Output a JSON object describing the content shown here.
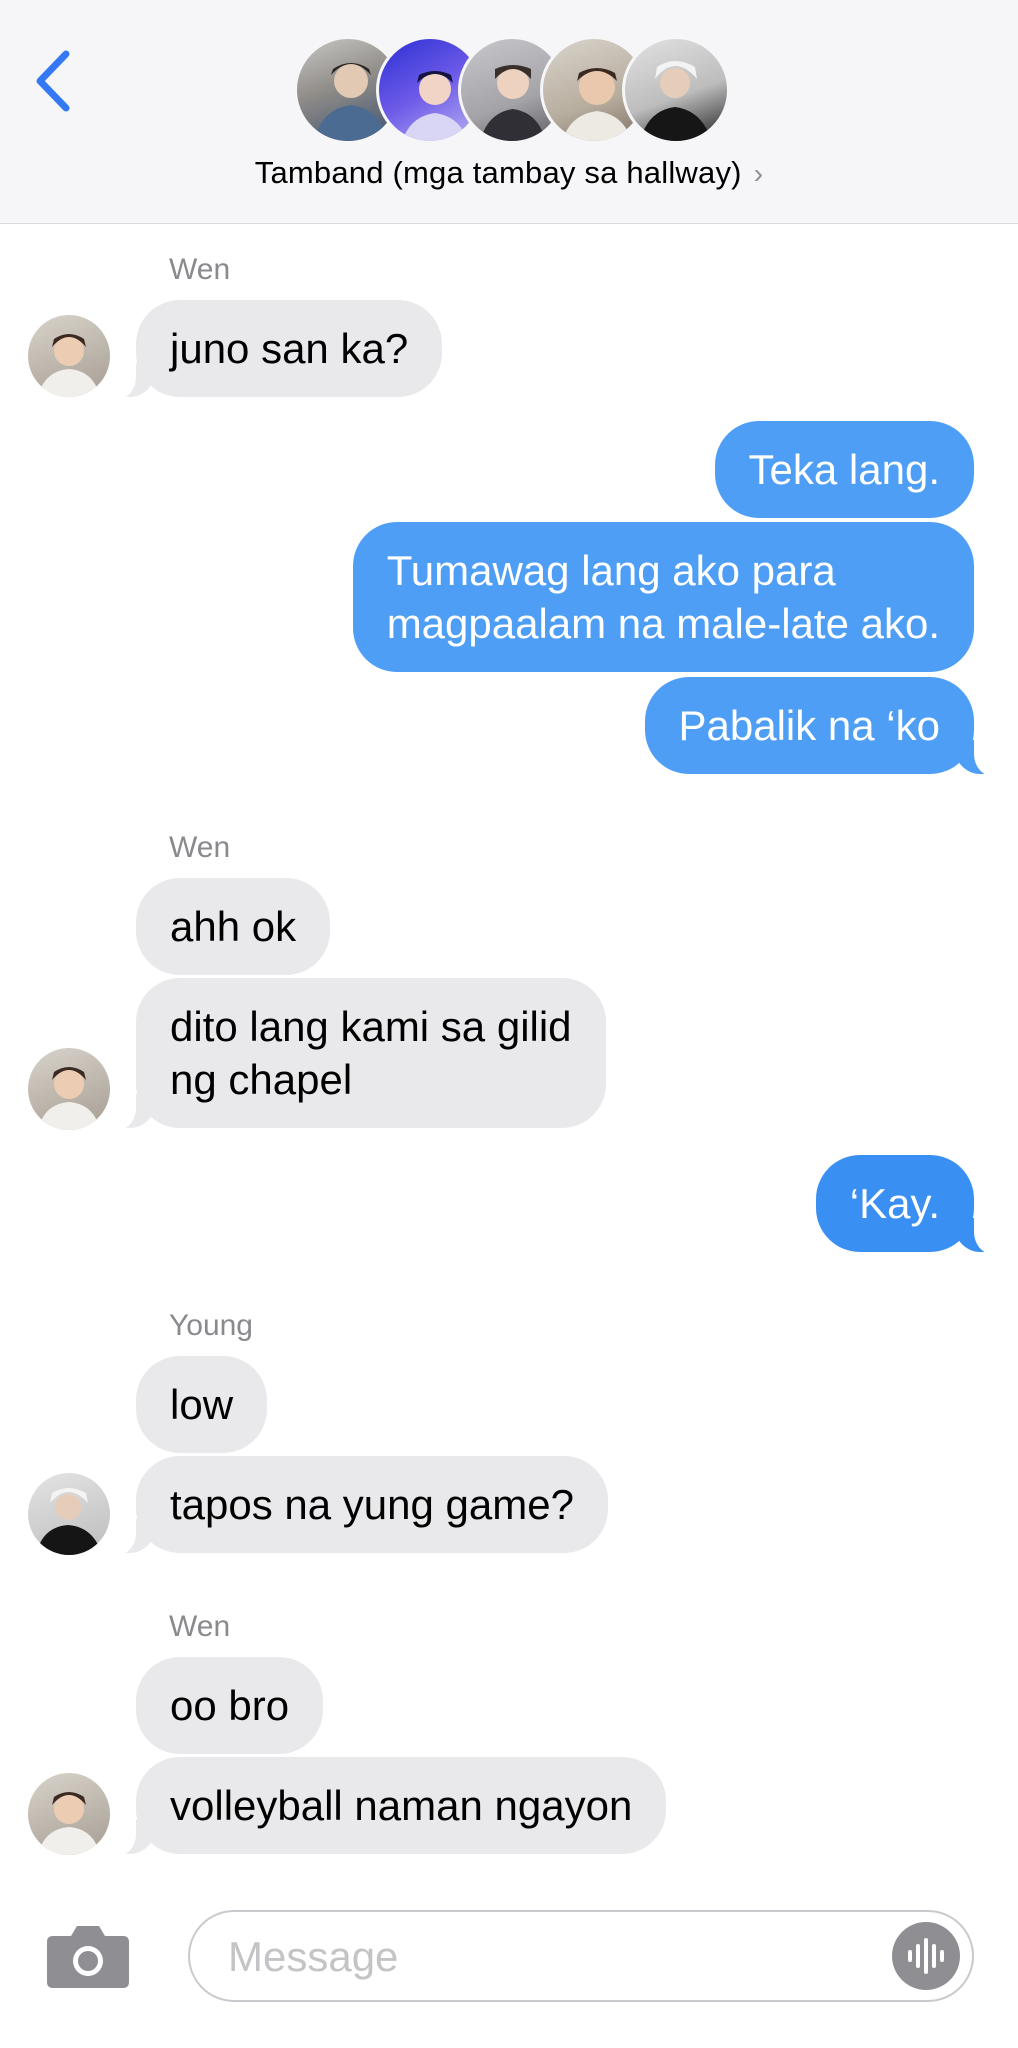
{
  "header": {
    "title": "Tamband (mga tambay sa hallway)",
    "avatars": [
      "member-1",
      "member-2",
      "member-3",
      "member-4",
      "member-5"
    ]
  },
  "messages": {
    "m1": {
      "sender": "Wen",
      "text": "juno san ka?"
    },
    "m2": {
      "text": "Teka lang."
    },
    "m3": {
      "line1": "Tumawag lang ako para",
      "line2": "magpaalam na male-late ako."
    },
    "m4": {
      "text": "Pabalik na ‘ko"
    },
    "m5": {
      "sender": "Wen",
      "text": "ahh ok"
    },
    "m6": {
      "line1": "dito lang kami sa gilid",
      "line2": "ng chapel"
    },
    "m7": {
      "text": "‘Kay."
    },
    "m8": {
      "sender": "Young",
      "text": "low"
    },
    "m9": {
      "text": "tapos na yung game?"
    },
    "m10": {
      "sender": "Wen",
      "text": "oo bro"
    },
    "m11": {
      "text": "volleyball naman ngayon"
    }
  },
  "composer": {
    "placeholder": "Message",
    "value": "",
    "camera_icon": "camera-icon",
    "audio_icon": "waveform-icon"
  },
  "colors": {
    "outgoing": "#4f9ef6",
    "incoming": "#e9e9eb",
    "accent": "#3478f6"
  }
}
